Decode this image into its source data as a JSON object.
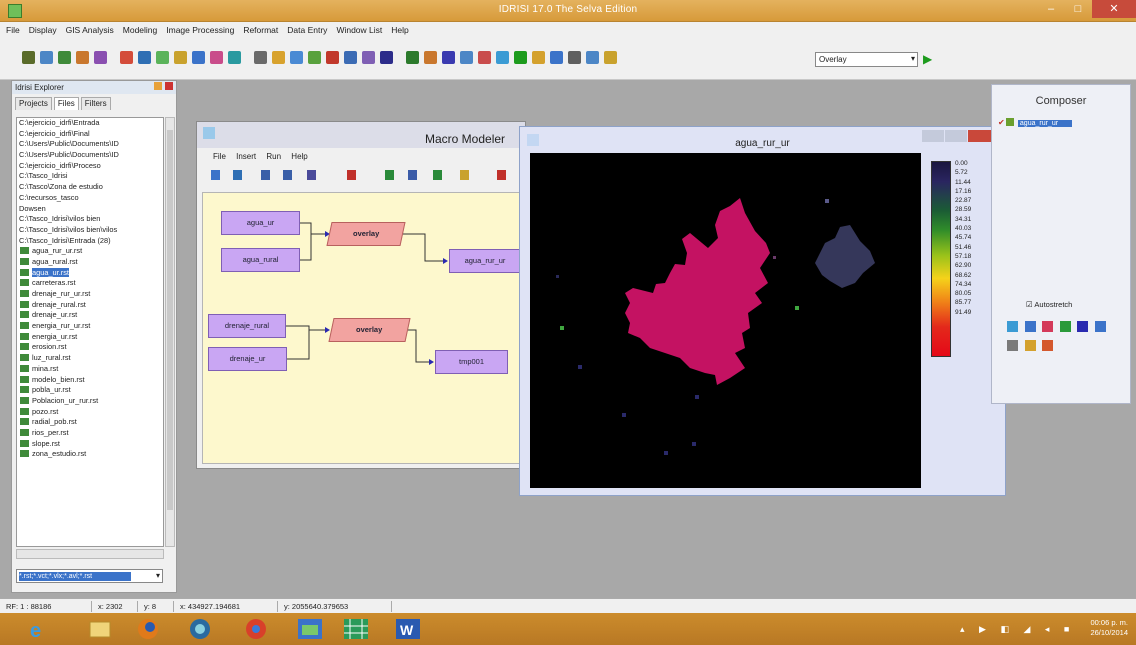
{
  "window": {
    "title": "IDRISI 17.0    The Selva Edition",
    "buttons": {
      "minimize": "–",
      "maximize": "□",
      "close": "✕"
    }
  },
  "menu": [
    "File",
    "Display",
    "GIS Analysis",
    "Modeling",
    "Image Processing",
    "Reformat",
    "Data Entry",
    "Window List",
    "Help"
  ],
  "toolbar": {
    "dropdown_value": "Overlay",
    "icon_colors": [
      "#5a6b2a",
      "#4c86c6",
      "#3f8a3a",
      "#c9772d",
      "#8a4fb0",
      "#d44c3a",
      "#2f6fb4",
      "#5ab35a",
      "#c9a22d",
      "#3b73c9",
      "#c94c8a",
      "#2a9aa0",
      "#6a6a6a",
      "#d8a22d",
      "#4a8ad4",
      "#59a13d",
      "#c1382b",
      "#3b6bb4",
      "#7f5fb4",
      "#2c2c8a",
      "#2c7a2c",
      "#c9772d",
      "#3a3ab0",
      "#4c86c6",
      "#c94c4c",
      "#3b9bd4",
      "#1d9b1d",
      "#d4a12d",
      "#3b73c9",
      "#5f5f5f",
      "#4c86c6",
      "#c9a22d"
    ]
  },
  "explorer": {
    "title": "Idrisi Explorer",
    "tabs": [
      "Projects",
      "Files",
      "Filters"
    ],
    "folders": [
      "C:\\ejercicio_idrfi\\Entrada",
      "C:\\ejercicio_idrfi\\Final",
      "C:\\Users\\Public\\Documents\\ID",
      "C:\\Users\\Public\\Documents\\ID",
      "C:\\ejercicio_idrfi\\Proceso",
      "C:\\Tasco_Idrisi",
      "C:\\Tasco\\Zona de estudio",
      "C:\\recursos_tasco",
      "Dowsen",
      "C:\\Tasco_Idrisi\\vilos bien",
      "C:\\Tasco_Idrisi\\vilos bien\\vilos",
      "C:\\Tasco_Idrisi\\Entrada (28)"
    ],
    "files": [
      {
        "name": "agua_rur_ur.rst",
        "selected": false
      },
      {
        "name": "agua_rural.rst",
        "selected": false
      },
      {
        "name": "agua_ur.rst",
        "selected": true
      },
      {
        "name": "carreteras.rst",
        "selected": false
      },
      {
        "name": "drenaje_rur_ur.rst",
        "selected": false
      },
      {
        "name": "drenaje_rural.rst",
        "selected": false
      },
      {
        "name": "drenaje_ur.rst",
        "selected": false
      },
      {
        "name": "energia_rur_ur.rst",
        "selected": false
      },
      {
        "name": "energia_ur.rst",
        "selected": false
      },
      {
        "name": "erosion.rst",
        "selected": false
      },
      {
        "name": "luz_rural.rst",
        "selected": false
      },
      {
        "name": "mina.rst",
        "selected": false
      },
      {
        "name": "modelo_bien.rst",
        "selected": false
      },
      {
        "name": "pobla_ur.rst",
        "selected": false
      },
      {
        "name": "Poblacion_ur_rur.rst",
        "selected": false
      },
      {
        "name": "pozo.rst",
        "selected": false
      },
      {
        "name": "radial_pob.rst",
        "selected": false
      },
      {
        "name": "rios_per.rst",
        "selected": false
      },
      {
        "name": "slope.rst",
        "selected": false
      },
      {
        "name": "zona_estudio.rst",
        "selected": false
      }
    ],
    "filter_value": "*.rst;*.vct;*.vlx;*.avl;*.rst"
  },
  "macro_modeler": {
    "title": "Macro Modeler",
    "menu": [
      "File",
      "Insert",
      "Run",
      "Help"
    ],
    "nodes": {
      "in1": "agua_ur",
      "in2": "agua_rural",
      "op1": "overlay",
      "out1": "agua_rur_ur",
      "in3": "drenaje_rural",
      "in4": "drenaje_ur",
      "op2": "overlay",
      "out2": "tmp001"
    }
  },
  "image_window": {
    "title": "agua_rur_ur",
    "legend_labels": [
      "0.00",
      "5.72",
      "11.44",
      "17.16",
      "22.87",
      "28.59",
      "34.31",
      "40.03",
      "45.74",
      "51.46",
      "57.18",
      "62.90",
      "68.62",
      "74.34",
      "80.05",
      "85.77",
      "91.49"
    ]
  },
  "composer": {
    "title": "Composer",
    "layer": "agua_rur_ur",
    "autostretch_label": "Autostretch"
  },
  "statusbar": {
    "rf": "RF: 1 : 88186",
    "x": "x: 2302",
    "y": "y: 8",
    "coordx": "x: 434927.194681",
    "coordy": "y: 2055640.379653"
  },
  "taskbar": {
    "clock_time": "00:06 p. m.",
    "clock_date": "26/10/2014"
  }
}
